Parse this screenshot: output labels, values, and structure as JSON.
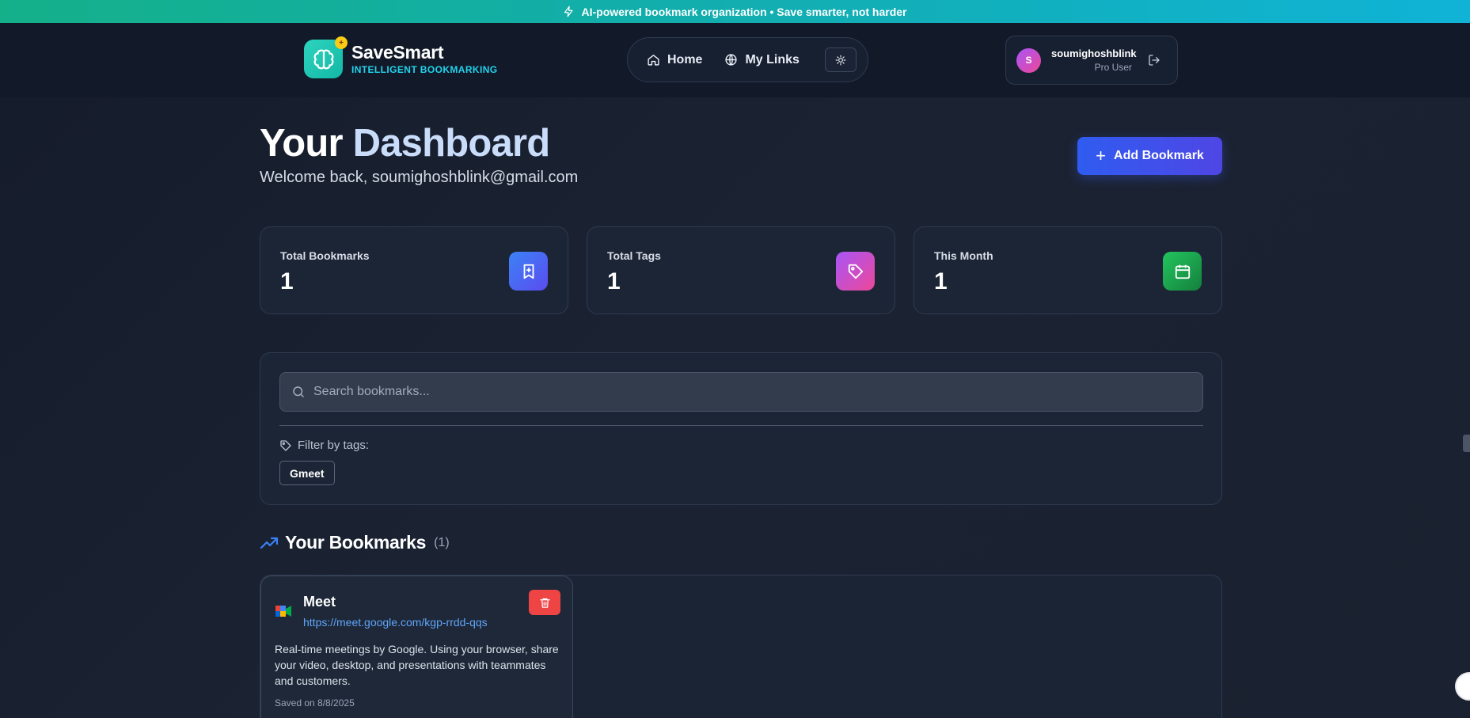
{
  "banner": {
    "text": "AI-powered bookmark organization • Save smarter, not harder",
    "icon": "bolt-icon"
  },
  "brand": {
    "name": "SaveSmart",
    "tagline": "INTELLIGENT BOOKMARKING",
    "logo_icon": "brain-icon",
    "badge": "+"
  },
  "nav": {
    "items": [
      {
        "label": "Home",
        "icon": "home-icon"
      },
      {
        "label": "My Links",
        "icon": "globe-icon"
      }
    ],
    "theme_icon": "sun-icon"
  },
  "user": {
    "initial": "S",
    "name": "soumighoshblink",
    "role": "Pro User",
    "logout_icon": "logout-icon"
  },
  "header": {
    "title_part1": "Your",
    "title_part2": "Dashboard",
    "welcome": "Welcome back, soumighoshblink@gmail.com",
    "add_button": "Add Bookmark"
  },
  "stats": [
    {
      "label": "Total Bookmarks",
      "value": "1",
      "icon": "bookmark-plus-icon",
      "color": "#4f5ff0"
    },
    {
      "label": "Total Tags",
      "value": "1",
      "icon": "tag-icon",
      "color": "#c53ccf"
    },
    {
      "label": "This Month",
      "value": "1",
      "icon": "calendar-icon",
      "color": "#16a34a"
    }
  ],
  "search": {
    "placeholder": "Search bookmarks..."
  },
  "filter": {
    "label": "Filter by tags:",
    "tags": [
      "Gmeet"
    ]
  },
  "bookmarks_section": {
    "title": "Your Bookmarks",
    "count": "(1)"
  },
  "bookmarks": [
    {
      "title": "Meet",
      "url": "https://meet.google.com/kgp-rrdd-qqs",
      "description": "Real-time meetings by Google. Using your browser, share your video, desktop, and presentations with teammates and customers.",
      "saved": "Saved on 8/8/2025"
    }
  ],
  "colors": {
    "accent": "#2f5cf0",
    "danger": "#ef4444",
    "link": "#60a5fa",
    "brand_teal": "#2dd4bf"
  }
}
